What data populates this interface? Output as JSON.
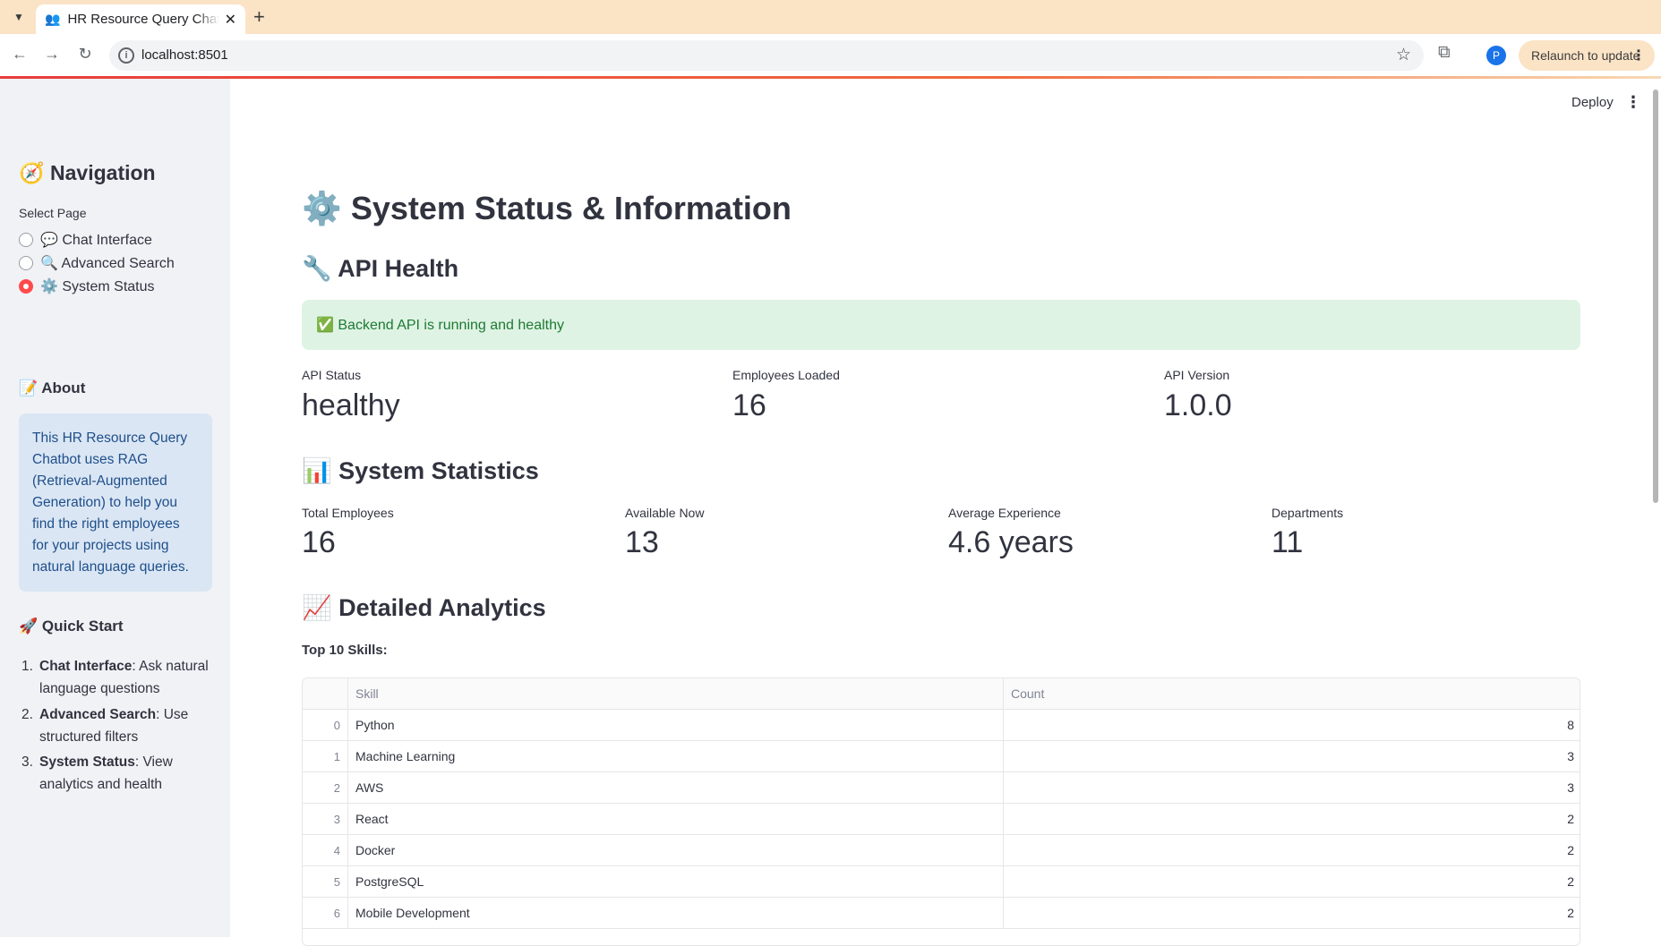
{
  "browser": {
    "tab_icon": "👥",
    "tab_title": "HR Resource Query Chatbot",
    "url": "localhost:8501",
    "avatar_letter": "P",
    "relaunch_label": "Relaunch to update"
  },
  "toolbar": {
    "deploy_label": "Deploy"
  },
  "sidebar": {
    "nav_title": "🧭 Navigation",
    "select_label": "Select Page",
    "pages": [
      {
        "label": "💬 Chat Interface",
        "selected": false
      },
      {
        "label": "🔍 Advanced Search",
        "selected": false
      },
      {
        "label": "⚙️ System Status",
        "selected": true
      }
    ],
    "about_title": "📝 About",
    "about_text": "This HR Resource Query Chatbot uses RAG (Retrieval-Augmented Generation) to help you find the right employees for your projects using natural language queries.",
    "quickstart_title": "🚀 Quick Start",
    "quickstart": [
      {
        "num": "1.",
        "bold": "Chat Interface",
        "rest": ": Ask natural language questions"
      },
      {
        "num": "2.",
        "bold": "Advanced Search",
        "rest": ": Use structured filters"
      },
      {
        "num": "3.",
        "bold": "System Status",
        "rest": ": View analytics and health"
      }
    ]
  },
  "main": {
    "title": "⚙️ System Status & Information",
    "api_health_title": "🔧 API Health",
    "health_message": "✅ Backend API is running and healthy",
    "health_metrics": [
      {
        "label": "API Status",
        "value": "healthy"
      },
      {
        "label": "Employees Loaded",
        "value": "16"
      },
      {
        "label": "API Version",
        "value": "1.0.0"
      }
    ],
    "stats_title": "📊 System Statistics",
    "stats_metrics": [
      {
        "label": "Total Employees",
        "value": "16"
      },
      {
        "label": "Available Now",
        "value": "13"
      },
      {
        "label": "Average Experience",
        "value": "4.6 years"
      },
      {
        "label": "Departments",
        "value": "11"
      }
    ],
    "analytics_title": "📈 Detailed Analytics",
    "skills_caption": "Top 10 Skills:",
    "skills_table": {
      "columns": [
        "Skill",
        "Count"
      ],
      "rows": [
        [
          "0",
          "Python",
          "8"
        ],
        [
          "1",
          "Machine Learning",
          "3"
        ],
        [
          "2",
          "AWS",
          "3"
        ],
        [
          "3",
          "React",
          "2"
        ],
        [
          "4",
          "Docker",
          "2"
        ],
        [
          "5",
          "PostgreSQL",
          "2"
        ],
        [
          "6",
          "Mobile Development",
          "2"
        ]
      ]
    }
  },
  "colors": {
    "accent": "#ff4b4b",
    "sidebar_bg": "#f0f2f6",
    "success_bg": "#dff3e4",
    "info_bg": "#dbe6f4"
  }
}
